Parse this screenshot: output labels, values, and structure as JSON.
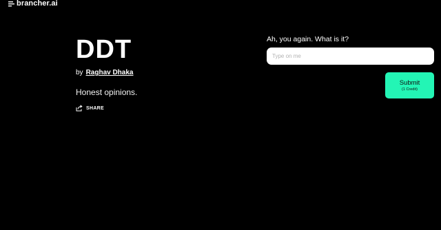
{
  "brand": {
    "logo_text": "brancher.ai"
  },
  "app": {
    "title": "DDT",
    "by_label": "by",
    "author": "Raghav Dhaka",
    "description": "Honest opinions.",
    "share_label": "SHARE"
  },
  "form": {
    "prompt": "Ah, you again. What is it?",
    "input_placeholder": "Type on me",
    "input_value": "",
    "submit_label": "Submit",
    "submit_cost": "(1 Credit)"
  },
  "colors": {
    "background": "#000000",
    "accent": "#23f5b5",
    "text": "#ffffff"
  },
  "icons": {
    "logo": "brancher-logo-icon",
    "share": "share-icon"
  }
}
